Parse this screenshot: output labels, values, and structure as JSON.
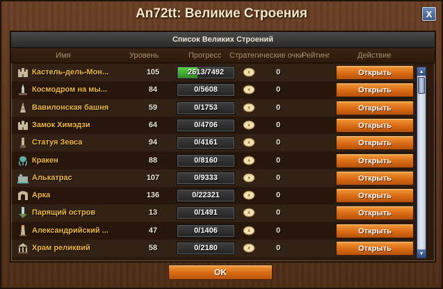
{
  "window": {
    "title": "An72tt: Великие Строения",
    "close_label": "X"
  },
  "panel": {
    "header": "Список Великих Строений"
  },
  "columns": {
    "name": "Имя",
    "level": "Уровень",
    "progress": "Прогресс",
    "strategic_points": "Стратегические очки",
    "rating": "Рейтинг",
    "action": "Действие"
  },
  "rows": [
    {
      "name": "Кастель-дель-Мон...",
      "level": "105",
      "progress_text": "2613/7492",
      "progress_fraction": 0.349,
      "rating": "0",
      "action": "Открыть",
      "icon": "castle-icon"
    },
    {
      "name": "Космодром на мы...",
      "level": "84",
      "progress_text": "0/5608",
      "progress_fraction": 0,
      "rating": "0",
      "action": "Открыть",
      "icon": "spaceport-icon"
    },
    {
      "name": "Вавилонская башня",
      "level": "59",
      "progress_text": "0/1753",
      "progress_fraction": 0,
      "rating": "0",
      "action": "Открыть",
      "icon": "tower-icon"
    },
    {
      "name": "Замок Химэдзи",
      "level": "64",
      "progress_text": "0/4706",
      "progress_fraction": 0,
      "rating": "0",
      "action": "Открыть",
      "icon": "castle-icon"
    },
    {
      "name": "Статуя Зевса",
      "level": "94",
      "progress_text": "0/4161",
      "progress_fraction": 0,
      "rating": "0",
      "action": "Открыть",
      "icon": "statue-icon"
    },
    {
      "name": "Кракен",
      "level": "88",
      "progress_text": "0/8160",
      "progress_fraction": 0,
      "rating": "0",
      "action": "Открыть",
      "icon": "kraken-icon"
    },
    {
      "name": "Алькатрас",
      "level": "107",
      "progress_text": "0/9333",
      "progress_fraction": 0,
      "rating": "0",
      "action": "Открыть",
      "icon": "prison-icon"
    },
    {
      "name": "Арка",
      "level": "136",
      "progress_text": "0/22321",
      "progress_fraction": 0,
      "rating": "0",
      "action": "Открыть",
      "icon": "arch-icon"
    },
    {
      "name": "Парящий остров",
      "level": "13",
      "progress_text": "0/1491",
      "progress_fraction": 0,
      "rating": "0",
      "action": "Открыть",
      "icon": "floating-island-icon"
    },
    {
      "name": "Александрийский ...",
      "level": "47",
      "progress_text": "0/1406",
      "progress_fraction": 0,
      "rating": "0",
      "action": "Открыть",
      "icon": "lighthouse-icon"
    },
    {
      "name": "Храм реликвий",
      "level": "58",
      "progress_text": "0/2180",
      "progress_fraction": 0,
      "rating": "0",
      "action": "Открыть",
      "icon": "temple-icon"
    }
  ],
  "footer": {
    "ok_label": "OK"
  },
  "colors": {
    "name_text": "#f2b93c",
    "button_orange": "#d86a14",
    "progress_green": "#2f8a22"
  }
}
